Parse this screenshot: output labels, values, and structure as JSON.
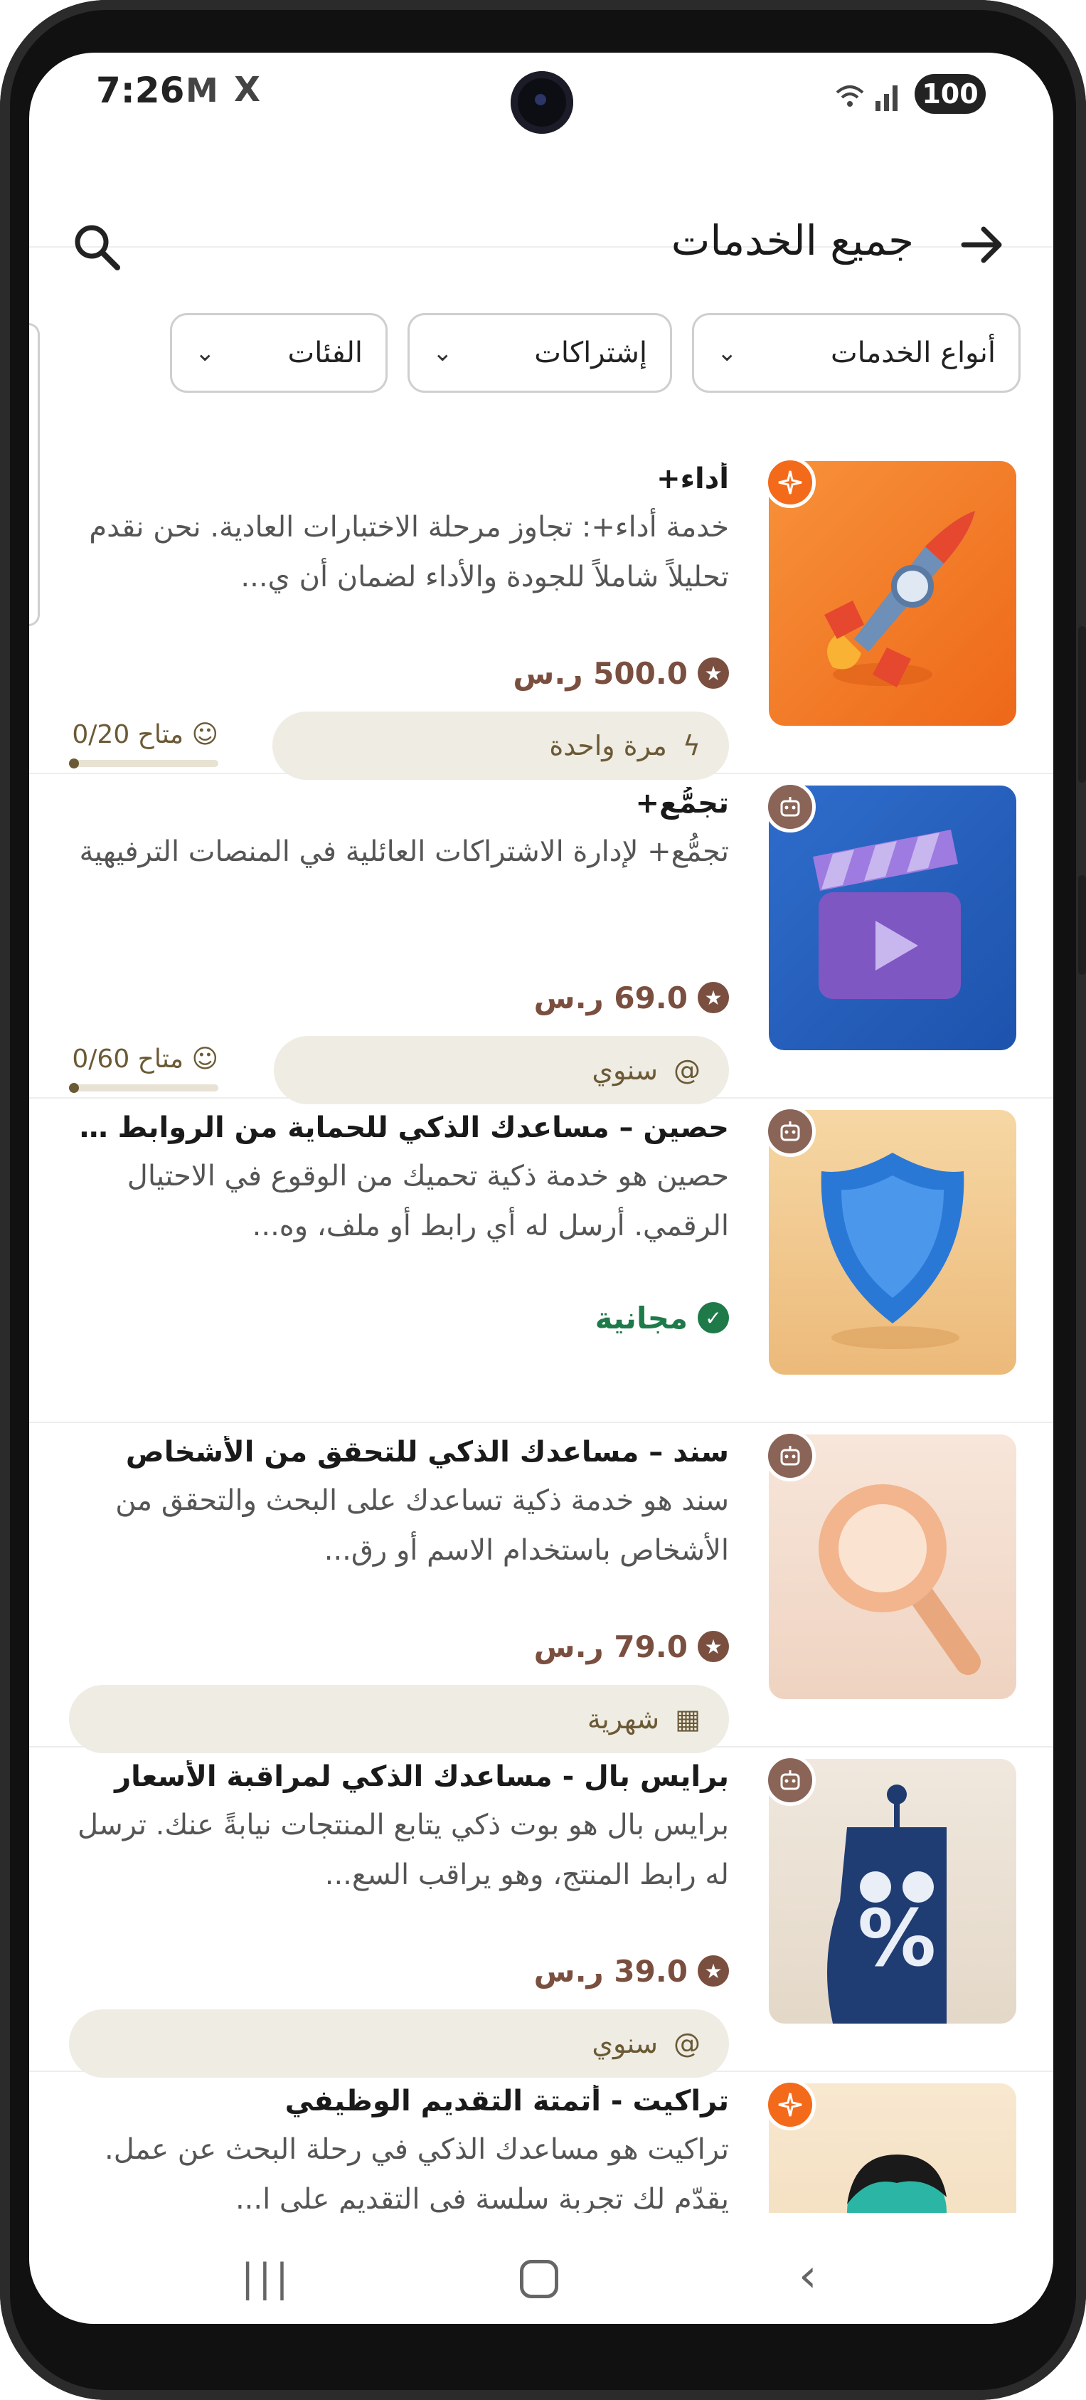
{
  "status_bar": {
    "time": "7:26",
    "icon1": "M",
    "icon2": "X",
    "battery": "100"
  },
  "header": {
    "title": "جميع الخدمات",
    "back_icon": "arrow-right-icon",
    "search_icon": "search-icon"
  },
  "filters": [
    {
      "label": "أنواع الخدمات"
    },
    {
      "label": "إشتراكات"
    },
    {
      "label": "الفئات"
    }
  ],
  "items": [
    {
      "title": "أداء+",
      "description": "خدمة أداء+: تجاوز مرحلة الاختبارات العادية. نحن نقدم تحليلاً شاملاً للجودة والأداء لضمان أن ي...",
      "price": "500.0 ر.س",
      "plan": "مرة واحدة",
      "availability": "متاح 0/20",
      "availability_fraction": 0,
      "badge": "sparkle-icon",
      "thumb_colors": [
        "#f6872b",
        "#ef6a1a"
      ]
    },
    {
      "title": "تجمُّع+",
      "description": "تجمُّع+ لإدارة الاشتراكات العائلية في المنصات الترفيهية",
      "price": "69.0 ر.س",
      "plan": "سنوي",
      "availability": "متاح 0/60",
      "availability_fraction": 0,
      "badge": "robot-icon",
      "thumb_colors": [
        "#2e6bc9",
        "#1f56b0"
      ]
    },
    {
      "title": "حصين – مساعدك الذكي للحماية من الروابط والا...",
      "description": "حصين هو خدمة ذكية تحميك من الوقوع في الاحتيال الرقمي. أرسل له أي رابط أو ملف، وه...",
      "price": "مجانية",
      "badge": "robot-icon",
      "thumb_colors": [
        "#f4cf97",
        "#ebbb7e"
      ]
    },
    {
      "title": "سند – مساعدك الذكي للتحقق من الأشخاص",
      "description": "سند هو خدمة ذكية تساعدك على البحث والتحقق من الأشخاص باستخدام الاسم أو رق...",
      "price": "79.0 ر.س",
      "plan": "شهرية",
      "badge": "robot-icon",
      "thumb_colors": [
        "#f6e3d6",
        "#eed2c0"
      ]
    },
    {
      "title": "برايس بال - مساعدك الذكي لمراقبة الأسعار",
      "description": "برايس بال هو بوت ذكي يتابع المنتجات نيابةً عنك. ترسل له رابط المنتج، وهو يراقب السع...",
      "price": "39.0 ر.س",
      "plan": "سنوي",
      "badge": "robot-icon",
      "thumb_colors": [
        "#efe7dc",
        "#e5dacb"
      ]
    },
    {
      "title": "تراكيت - أتمتة التقديم الوظيفي",
      "description": "تراكيت هو مساعدك الذكي في رحلة البحث عن عمل. يقدّم لك تجربة سلسة في التقديم على ا...",
      "badge": "sparkle-icon",
      "thumb_colors": [
        "#f8e6cc",
        "#f1d8b5"
      ]
    }
  ],
  "nav": {
    "recents": "|||",
    "home": "home-icon",
    "back": "‹"
  }
}
